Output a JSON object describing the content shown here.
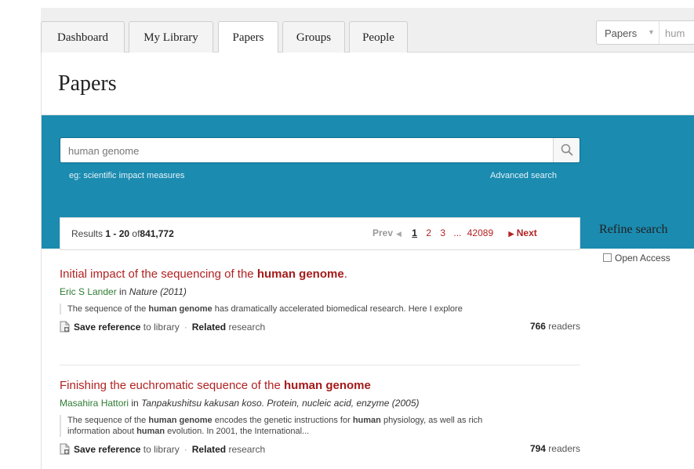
{
  "tabs": [
    {
      "label": "Dashboard"
    },
    {
      "label": "My Library"
    },
    {
      "label": "Papers"
    },
    {
      "label": "Groups"
    },
    {
      "label": "People"
    }
  ],
  "header_search": {
    "type_selected": "Papers",
    "query_preview": "hum"
  },
  "page_title": "Papers",
  "search": {
    "query": "human genome",
    "example": "eg: scientific impact measures",
    "advanced_label": "Advanced search"
  },
  "results": {
    "prefix": "Results",
    "range": "1 - 20",
    "of": "of",
    "total": "841,772",
    "prev": "Prev",
    "pages": [
      "1",
      "2",
      "3"
    ],
    "ellipsis": "...",
    "last_page": "42089",
    "next": "Next"
  },
  "refine": {
    "title": "Refine search",
    "open_access": "Open Access"
  },
  "papers": [
    {
      "title_pre": "Initial impact of the sequencing of the ",
      "title_bold": "human genome",
      "title_post": ".",
      "author": "Eric S Lander",
      "in": "in",
      "journal": "Nature (2011)",
      "abstract_1": "The sequence of the ",
      "abstract_b1": "human genome",
      "abstract_2": " has dramatically accelerated biomedical research. Here I explore",
      "save": "Save reference",
      "save_tail": " to library",
      "related": "Related",
      "related_tail": " research",
      "readers_count": "766",
      "readers_label": " readers"
    },
    {
      "title_pre": "Finishing the euchromatic sequence of the ",
      "title_bold": "human genome",
      "title_post": "",
      "author": "Masahira Hattori",
      "in": "in",
      "journal": "Tanpakushitsu kakusan koso. Protein, nucleic acid, enzyme (2005)",
      "abstract_1": "The sequence of the ",
      "abstract_b1": "human genome",
      "abstract_2": " encodes the genetic instructions for ",
      "abstract_b2": "human",
      "abstract_3": " physiology, as well as rich information about ",
      "abstract_b3": "human",
      "abstract_4": " evolution. In 2001, the International...",
      "save": "Save reference",
      "save_tail": " to library",
      "related": "Related",
      "related_tail": " research",
      "readers_count": "794",
      "readers_label": " readers"
    }
  ],
  "icons": {
    "search": "magnifier-icon",
    "save": "document-add-icon",
    "caret": "caret-down-icon"
  }
}
